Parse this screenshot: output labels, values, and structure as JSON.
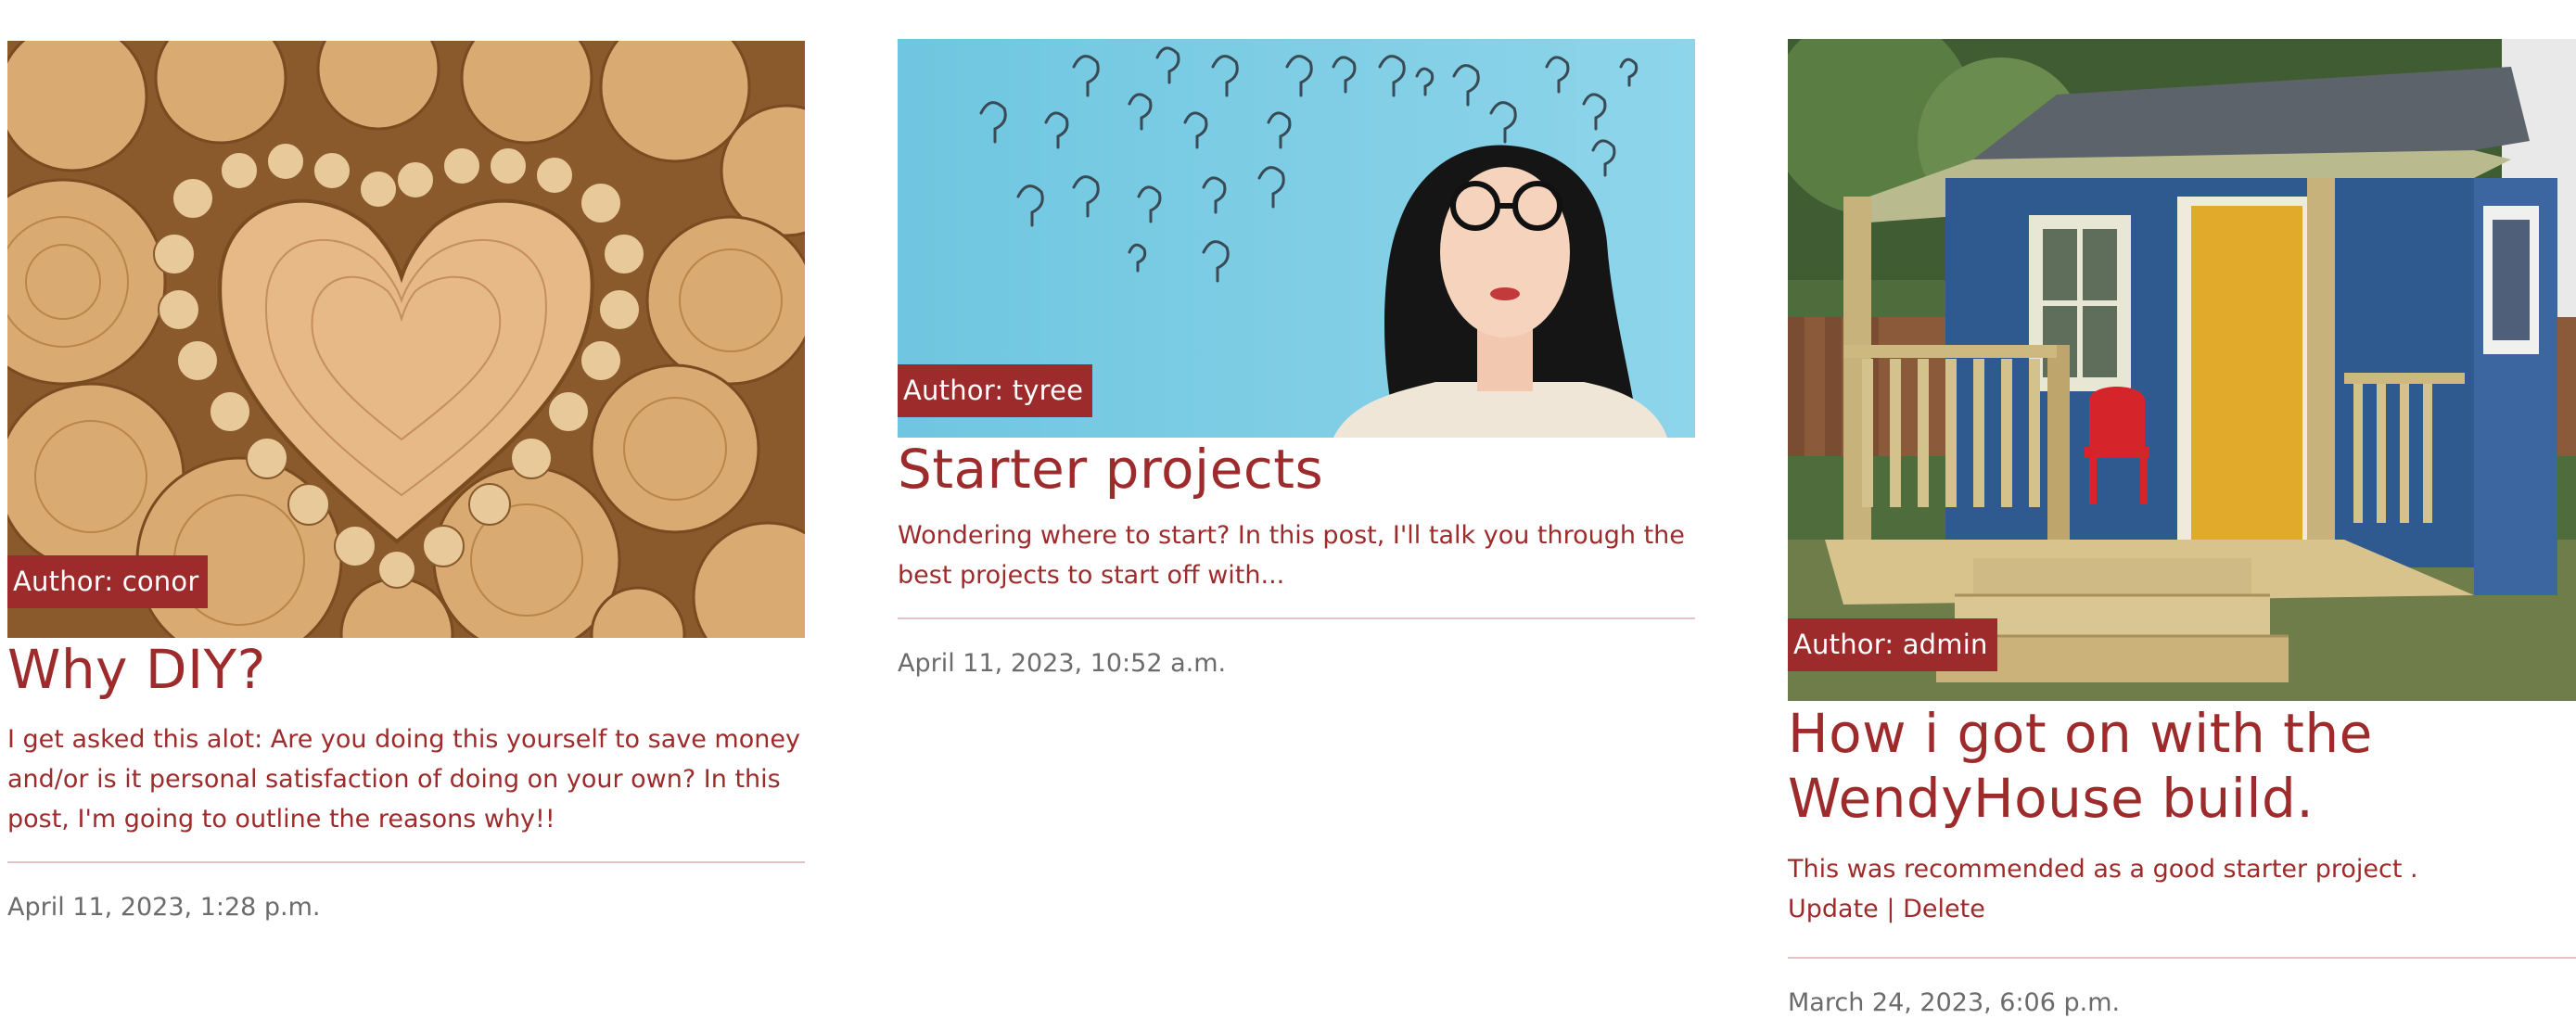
{
  "posts": [
    {
      "author": "Author: conor",
      "title": "Why DIY?",
      "excerpt": "I get asked this alot: Are you doing this yourself to save money and/or is it personal satisfaction of doing on your own? In this post, I'm going to outline the reasons why!!",
      "date": "April 11, 2023, 1:28 p.m."
    },
    {
      "author": "Author: tyree",
      "title": "Starter projects",
      "excerpt": "Wondering where to start? In this post, I'll talk you through the best projects to start off with...",
      "date": "April 11, 2023, 10:52 a.m."
    },
    {
      "author": "Author: admin",
      "title": "How i got on with the WendyHouse build.",
      "excerpt": "This was recommended as a good starter project .",
      "update_label": "Update",
      "separator": "|",
      "delete_label": "Delete",
      "date": "March 24, 2023, 6:06 p.m."
    }
  ],
  "colors": {
    "accent": "#9e2b2b",
    "date_text": "#6b6b6b",
    "divider": "#e2c4c4"
  }
}
